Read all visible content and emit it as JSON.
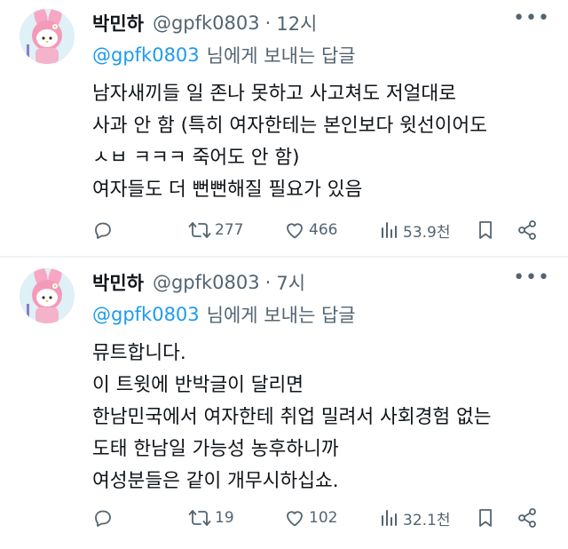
{
  "tweets": [
    {
      "author_name": "박민하",
      "author_handle": "@gpfk0803",
      "separator": "·",
      "time": "12시",
      "reply_to_handle": "@gpfk0803",
      "reply_suffix": "님에게 보내는 답글",
      "lines": [
        "남자새끼들 일 존나 못하고 사고쳐도 저얼대로",
        "사과 안 함 (특히 여자한테는 본인보다 윗선이어도",
        "ㅅㅂ ㅋㅋㅋ 죽어도 안 함)",
        "여자들도 더 뻔뻔해질 필요가 있음"
      ],
      "stats": {
        "reposts": "277",
        "likes": "466",
        "views": "53.9천"
      },
      "icons": [
        "reply-icon",
        "repost-icon",
        "like-icon",
        "views-icon",
        "bookmark-icon",
        "share-icon"
      ]
    },
    {
      "author_name": "박민하",
      "author_handle": "@gpfk0803",
      "separator": "·",
      "time": "7시",
      "reply_to_handle": "@gpfk0803",
      "reply_suffix": "님에게 보내는 답글",
      "lines": [
        "뮤트합니다.",
        "이 트윗에 반박글이 달리면",
        "한남민국에서 여자한테 취업 밀려서 사회경험 없는",
        "도태 한남일 가능성 농후하니까",
        "여성분들은 같이 개무시하십쇼."
      ],
      "stats": {
        "reposts": "19",
        "likes": "102",
        "views": "32.1천"
      },
      "icons": [
        "reply-icon",
        "repost-icon",
        "like-icon",
        "views-icon",
        "bookmark-icon",
        "share-icon"
      ]
    }
  ],
  "colors": {
    "text": "#0f1419",
    "secondary": "#536471",
    "link": "#1d9bf0",
    "divider": "#eff3f4"
  }
}
